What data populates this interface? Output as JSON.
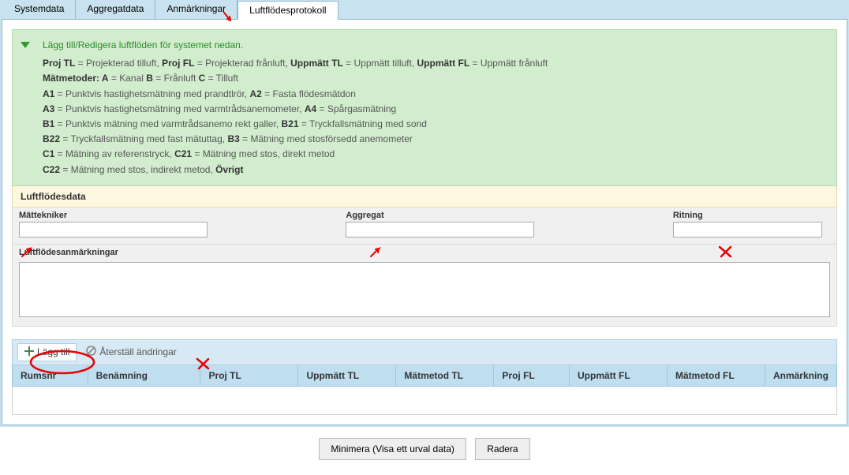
{
  "tabs": {
    "systemdata": "Systemdata",
    "aggregatdata": "Aggregatdata",
    "anmarkningar": "Anmärkningar",
    "luftflodesprotokoll": "Luftflödesprotokoll"
  },
  "info": {
    "title": "Lägg till/Redigera luftflöden för systemet nedan.",
    "l1_a": "Proj TL",
    "l1_b": " = Projekterad tilluft, ",
    "l1_c": "Proj FL",
    "l1_d": " = Projekterad frånluft, ",
    "l1_e": "Uppmätt TL",
    "l1_f": " = Uppmätt tilluft, ",
    "l1_g": "Uppmätt FL",
    "l1_h": " = Uppmätt frånluft",
    "l2": "Mätmetoder: A",
    "l2b": " = Kanal ",
    "l2c": "B",
    "l2d": " = Frånluft ",
    "l2e": "C",
    "l2f": " = Tilluft",
    "l3a": "A1",
    "l3b": " = Punktvis hastighetsmätning med prandtlrör, ",
    "l3c": "A2",
    "l3d": " = Fasta flödesmätdon",
    "l4a": "A3",
    "l4b": " = Punktvis hastighetsmätning med varmtrådsanemometer, ",
    "l4c": "A4",
    "l4d": " = Spårgasmätning",
    "l5a": "B1",
    "l5b": " = Punktvis mätning med varmtrådsanemo rekt galler, ",
    "l5c": "B21",
    "l5d": " = Tryckfallsmätning med sond",
    "l6a": "B22",
    "l6b": " = Tryckfallsmätning med fast mätuttag, ",
    "l6c": "B3",
    "l6d": " = Mätning med stosförsedd anemometer",
    "l7a": "C1",
    "l7b": " = Mätning av referenstryck, ",
    "l7c": "C21",
    "l7d": " = Mätning med stos, direkt metod",
    "l8a": "C22",
    "l8b": " = Mätning med stos, indirekt metod, ",
    "l8c": "Övrigt"
  },
  "section": {
    "luftflodesdata": "Luftflödesdata"
  },
  "form": {
    "mattekniker_label": "Mättekniker",
    "aggregat_label": "Aggregat",
    "ritning_label": "Ritning",
    "anm_label": "Luftflödesanmärkningar",
    "mattekniker_value": "",
    "aggregat_value": "",
    "ritning_value": "",
    "anm_value": ""
  },
  "toolbar": {
    "add": "Lägg till",
    "reset": "Återställ ändringar"
  },
  "columns": {
    "c1": "Rumsnr",
    "c2": "Benämning",
    "c3": "Proj TL",
    "c4": "Uppmätt TL",
    "c5": "Mätmetod TL",
    "c6": "Proj FL",
    "c7": "Uppmätt FL",
    "c8": "Mätmetod FL",
    "c9": "Anmärkning"
  },
  "buttons": {
    "minimera": "Minimera (Visa ett urval data)",
    "radera": "Radera"
  }
}
